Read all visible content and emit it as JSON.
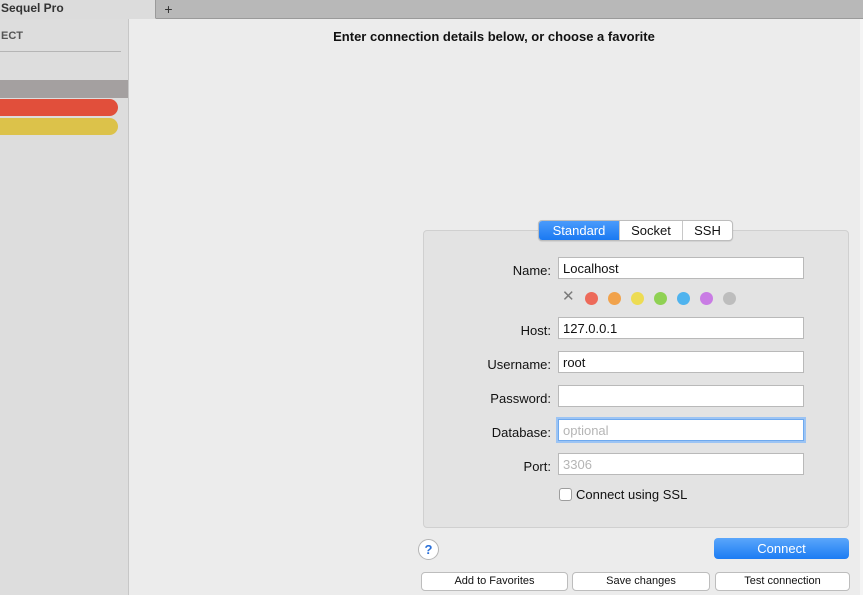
{
  "window": {
    "tab_title": "Sequel Pro",
    "add_tab_label": "+"
  },
  "sidebar": {
    "header": "ECT",
    "favorites": [
      {
        "color": "#a4a0a0",
        "selected": true
      },
      {
        "color": "#e14f3b",
        "selected": false
      },
      {
        "color": "#dcc24a",
        "selected": false
      }
    ]
  },
  "main": {
    "title": "Enter connection details below, or choose a favorite"
  },
  "tabs": [
    {
      "label": "Standard",
      "active": true
    },
    {
      "label": "Socket",
      "active": false
    },
    {
      "label": "SSH",
      "active": false
    }
  ],
  "form": {
    "name_label": "Name:",
    "name_value": "Localhost",
    "color_clear_icon": "x-icon",
    "colors": [
      "#ed6a5a",
      "#f1a24b",
      "#eddc53",
      "#8fd153",
      "#4fb3ee",
      "#c97ce4",
      "#bdbdbd"
    ],
    "host_label": "Host:",
    "host_value": "127.0.0.1",
    "username_label": "Username:",
    "username_value": "root",
    "password_label": "Password:",
    "password_value": "",
    "database_label": "Database:",
    "database_placeholder": "optional",
    "port_label": "Port:",
    "port_placeholder": "3306",
    "ssl_label": "Connect using SSL",
    "ssl_checked": false
  },
  "buttons": {
    "help": "?",
    "connect": "Connect",
    "add_favorites": "Add to Favorites",
    "save_changes": "Save changes",
    "test_connection": "Test connection"
  },
  "colors": {
    "accent": "#1a79f2",
    "background": "#ececec",
    "sidebar": "#dddddd"
  }
}
